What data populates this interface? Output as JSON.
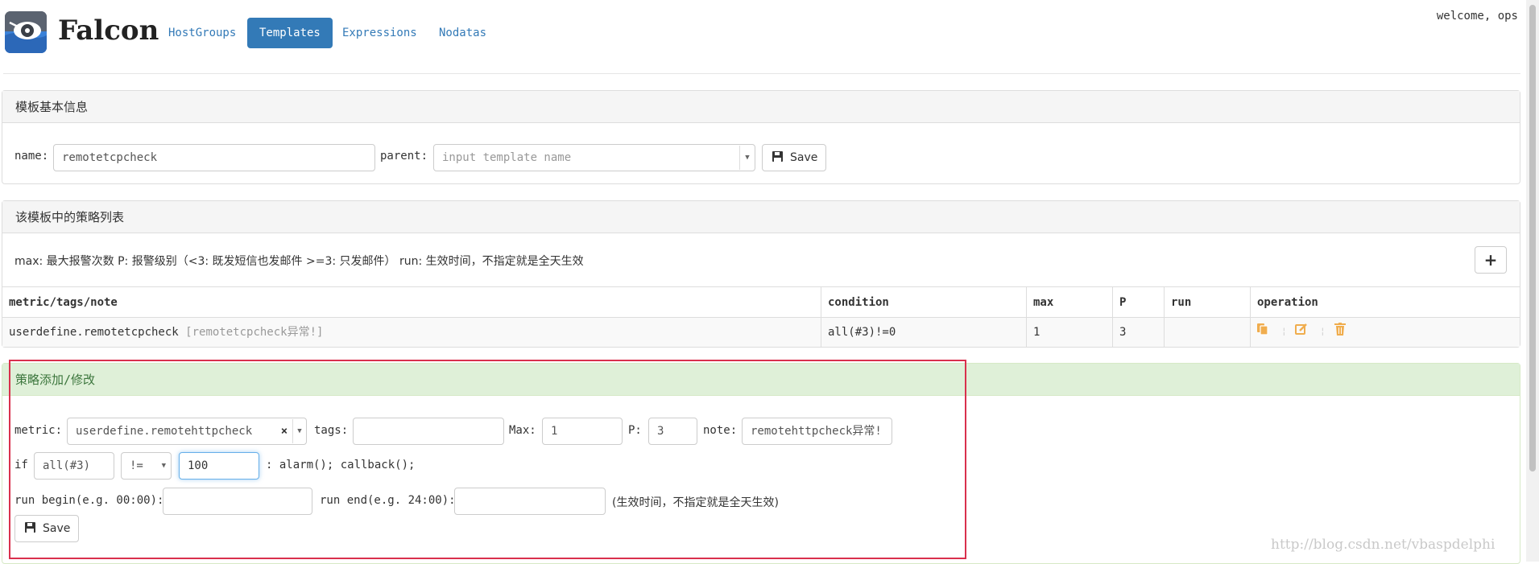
{
  "header": {
    "brand": "Falcon",
    "nav": [
      "HostGroups",
      "Templates",
      "Expressions",
      "Nodatas"
    ],
    "active_nav": "Templates",
    "welcome": "welcome, ops"
  },
  "basic_panel": {
    "title": "模板基本信息",
    "name_label": "name:",
    "name_value": "remotetcpcheck",
    "parent_label": "parent:",
    "parent_placeholder": "input template name",
    "save_label": "Save"
  },
  "strategy_panel": {
    "title": "该模板中的策略列表",
    "legend": "max: 最大报警次数 P: 报警级别（<3: 既发短信也发邮件 >=3: 只发邮件） run: 生效时间，不指定就是全天生效",
    "add_symbol": "+",
    "columns": [
      "metric/tags/note",
      "condition",
      "max",
      "P",
      "run",
      "operation"
    ],
    "rows": [
      {
        "metric": "userdefine.remotetcpcheck",
        "note": "[remotetcpcheck异常!]",
        "condition": "all(#3)!=0",
        "max": "1",
        "p": "3",
        "run": ""
      }
    ]
  },
  "edit_panel": {
    "title": "策略添加/修改",
    "metric_label": "metric:",
    "metric_value": "userdefine.remotehttpcheck",
    "clear_symbol": "×",
    "tags_label": "tags:",
    "tags_value": "",
    "max_label": "Max:",
    "max_value": "1",
    "p_label": "P:",
    "p_value": "3",
    "note_label": "note:",
    "note_value": "remotehttpcheck异常!",
    "if_label": "if",
    "func_value": "all(#3)",
    "operator_value": "!=",
    "threshold_value": "100",
    "action_text": ": alarm(); callback();",
    "run_begin_label": "run begin(e.g. 00:00):",
    "run_end_label": "run end(e.g. 24:00):",
    "run_hint": "(生效时间，不指定就是全天生效)",
    "save_label": "Save"
  },
  "watermark": "http://blog.csdn.net/vbaspdelphi",
  "colors": {
    "primary": "#337ab7",
    "success_bg": "#dff0d8",
    "success_text": "#3c763d",
    "warning_icon": "#f0ad4e",
    "highlight_border": "#d9304d"
  }
}
